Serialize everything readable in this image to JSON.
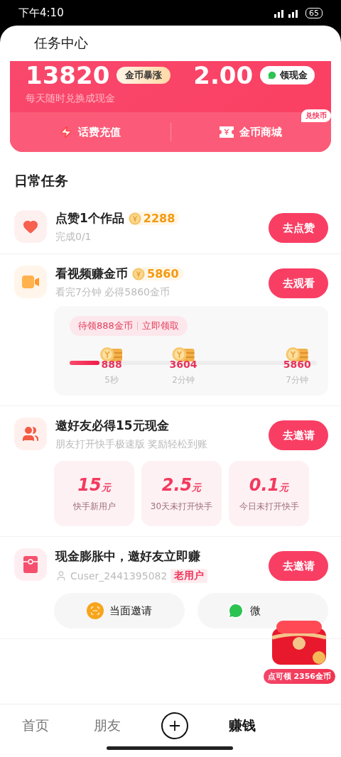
{
  "status_bar": {
    "time": "下午4:10",
    "battery": "65"
  },
  "header": {
    "title": "任务中心"
  },
  "balance_card": {
    "coins": "13820",
    "coin_tag": "金币暴涨",
    "cash": "2.00",
    "cash_button": "领现金",
    "subtitle": "每天随时兑换成现金",
    "actions": [
      {
        "kind": "phone",
        "label": "话费充值"
      },
      {
        "kind": "shop",
        "label": "金币商城",
        "badge": "兑快币"
      }
    ]
  },
  "section_title": "日常任务",
  "tasks": [
    {
      "kind": "like",
      "title": "点赞1个作品",
      "reward": "2288",
      "subtitle": "完成0/1",
      "button": "去点赞"
    },
    {
      "kind": "video",
      "title": "看视频赚金币",
      "reward": "5860",
      "subtitle": "看完7分钟 必得5860金币",
      "button": "去观看",
      "progress": {
        "bubble": "待领888金币",
        "bubble_action": "立即领取",
        "level": 0.12,
        "milestones": [
          {
            "amount": "888",
            "time": "5秒"
          },
          {
            "amount": "3604",
            "time": "2分钟"
          },
          {
            "amount": "5860",
            "time": "7分钟"
          }
        ]
      }
    },
    {
      "kind": "invite",
      "title": "邀好友必得15元现金",
      "subtitle": "朋友打开快手极速版 奖励轻松到账",
      "button": "去邀请",
      "rewards": [
        {
          "amount": "15",
          "unit": "元",
          "label": "快手新用户"
        },
        {
          "amount": "2.5",
          "unit": "元",
          "label": "30天未打开快手"
        },
        {
          "amount": "0.1",
          "unit": "元",
          "label": "今日未打开快手"
        }
      ]
    },
    {
      "kind": "cash",
      "title": "现金膨胀中，邀好友立即赚",
      "user": "Cuser_2441395082",
      "user_tag": "老用户",
      "button": "去邀请",
      "share_buttons": [
        {
          "kind": "face",
          "label": "当面邀请"
        },
        {
          "kind": "wechat",
          "label": "微"
        }
      ]
    }
  ],
  "floating_reward": {
    "label": "点可领 2356金币"
  },
  "bottom_nav": [
    {
      "kind": "text",
      "label": "首页",
      "selected": false
    },
    {
      "kind": "text",
      "label": "朋友",
      "selected": false
    },
    {
      "kind": "add",
      "selected": false
    },
    {
      "kind": "text",
      "label": "赚钱",
      "selected": true
    }
  ]
}
